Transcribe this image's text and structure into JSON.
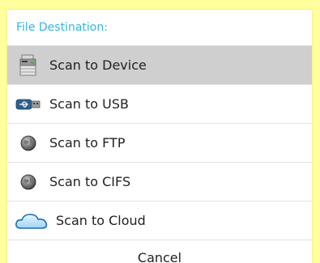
{
  "dialog": {
    "title": "File Destination:",
    "title_color": "#33b5e5",
    "options": [
      {
        "label": "Scan to Device",
        "icon": "printer-icon",
        "selected": true
      },
      {
        "label": "Scan to USB",
        "icon": "usb-icon",
        "selected": false
      },
      {
        "label": "Scan to FTP",
        "icon": "globe-icon",
        "selected": false
      },
      {
        "label": "Scan to CIFS",
        "icon": "globe-icon",
        "selected": false
      },
      {
        "label": "Scan to Cloud",
        "icon": "cloud-icon",
        "selected": false
      }
    ],
    "cancel_label": "Cancel"
  }
}
